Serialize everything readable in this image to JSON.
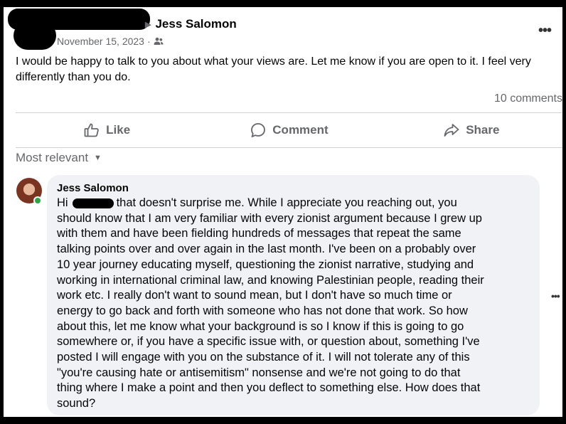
{
  "post": {
    "author": "Jess Salomon",
    "date": "November 15, 2023",
    "date_separator": "·",
    "audience_icon": "friends-icon",
    "more_label": "•••",
    "body": "I would be happy to talk to you about what your views are. Let me know if you are open to it. I feel very differently than you do.",
    "comment_count": "10 comments"
  },
  "actions": [
    {
      "label": "Like",
      "icon": "thumbs-up-icon"
    },
    {
      "label": "Comment",
      "icon": "comment-icon"
    },
    {
      "label": "Share",
      "icon": "share-icon"
    }
  ],
  "sort": {
    "label": "Most relevant"
  },
  "comment": {
    "author": "Jess Salomon",
    "text_greeting": "Hi",
    "text": "that doesn't surprise me. While I appreciate you reaching out, you\nshould know that I am very familiar with every zionist argument because I grew up\nwith them and have been fielding hundreds of messages that repeat the same\ntalking points over and over again in the last month. I've been on a probably over\n10 year journey educating myself, questioning the zionist narrative, studying and\nworking in international criminal law, and knowing Palestinian people, reading their\nwork etc. I really don't want to sound mean, but I don't have so much time or\nenergy to go back and forth with someone who has not done that work. So how\nabout this, let me know what your background is so I know if this is going to go\nsomewhere or, if you have a specific issue with, or question about, something I've\nposted I will engage with you on the substance of it. I will not tolerate any of this\n\"you're causing hate or antisemitism\" nonsense and we're not going to do that\nthing where I make a point and then you deflect to something else. How does that\nsound?",
    "more_label": "•••"
  },
  "colors": {
    "secondary_text": "#65676b",
    "bubble": "#f0f2f5",
    "online": "#31a24c"
  }
}
